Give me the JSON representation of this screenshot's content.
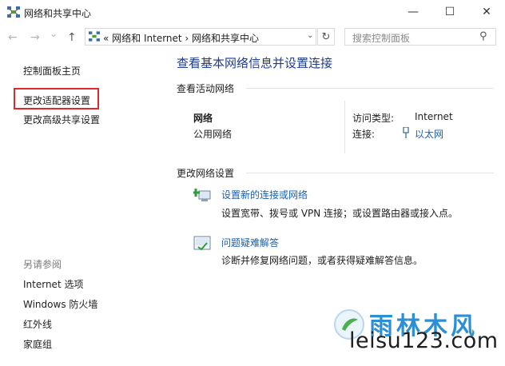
{
  "window": {
    "title": "网络和共享中心",
    "minimize_glyph": "—",
    "maximize_glyph": "☐",
    "close_glyph": "✕"
  },
  "nav": {
    "back_glyph": "←",
    "forward_glyph": "→",
    "dropdown_glyph": "⌄",
    "up_glyph": "↑",
    "address_path": "« 网络和 Internet  ›  网络和共享中心",
    "address_chevron": "⌄",
    "refresh_glyph": "↻",
    "search_placeholder": "搜索控制面板",
    "search_glyph": "⚲"
  },
  "sidebar": {
    "home": "控制面板主页",
    "change_adapter": "更改适配器设置",
    "change_sharing": "更改高级共享设置",
    "see_also_title": "另请参阅",
    "see_also": [
      "Internet 选项",
      "Windows 防火墙",
      "红外线",
      "家庭组"
    ]
  },
  "main": {
    "title": "查看基本网络信息并设置连接",
    "active_networks_title": "查看活动网络",
    "network_name": "网络",
    "network_type": "公用网络",
    "access_type_label": "访问类型:",
    "access_type_value": "Internet",
    "connection_label": "连接:",
    "connection_value": "以太网",
    "change_settings_title": "更改网络设置",
    "setup_link": "设置新的连接或网络",
    "setup_desc": "设置宽带、拨号或 VPN 连接；或设置路由器或接入点。",
    "troubleshoot_link": "问题疑难解答",
    "troubleshoot_desc": "诊断并修复网络问题，或者获得疑难解答信息。"
  },
  "watermark": {
    "brand": "雨林木风",
    "url": "leisu123.com"
  },
  "colors": {
    "link": "#1a5fb4",
    "title": "#1e3b90",
    "highlight": "#e0282b"
  }
}
